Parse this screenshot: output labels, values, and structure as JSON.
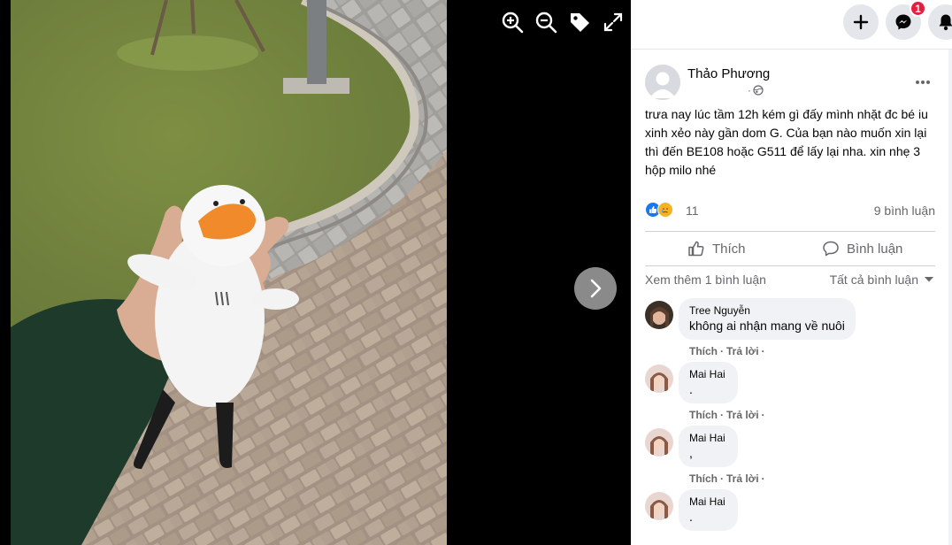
{
  "viewer": {
    "tools": [
      {
        "name": "zoom-in-icon"
      },
      {
        "name": "zoom-out-icon"
      },
      {
        "name": "tag-icon"
      },
      {
        "name": "fullscreen-icon"
      }
    ],
    "next_icon": "chevron-right-icon"
  },
  "topbar": {
    "create_icon": "plus-icon",
    "messenger_icon": "messenger-icon",
    "messenger_badge": "1",
    "notifications_icon": "bell-icon"
  },
  "post": {
    "author": "Thảo Phương",
    "meta_separator": "·",
    "privacy_icon": "public-globe-icon",
    "text": "trưa nay lúc tầm 12h kém gì đấy mình nhặt đc bé iu xinh xẻo này gần dom G. Của bạn nào muốn xin lại thì đến BE108 hoặc G511 để lấy lại nha. xin nhẹ 3 hộp milo nhé",
    "reactions": [
      "like",
      "care"
    ],
    "reaction_count": "11",
    "comment_count": "9 bình luận",
    "like_label": "Thích",
    "comment_label": "Bình luận",
    "view_more": "Xem thêm 1 bình luận",
    "filter_label": "Tất cả bình luận"
  },
  "comments": [
    {
      "name": "Tree Nguyễn",
      "text": "không ai nhận mang về nuôi",
      "like": "Thích",
      "reply": "Trả lời",
      "sep": "·"
    },
    {
      "name": "Mai Hai",
      "text": ".",
      "like": "Thích",
      "reply": "Trả lời",
      "sep": "·"
    },
    {
      "name": "Mai Hai",
      "text": ",",
      "like": "Thích",
      "reply": "Trả lời",
      "sep": "·"
    },
    {
      "name": "Mai Hai",
      "text": ".",
      "like": "Thích",
      "reply": "Trả lời",
      "sep": "·"
    }
  ],
  "colors": {
    "accent": "#1877f2",
    "badge": "#e41e3f",
    "secondary_text": "#65676b"
  }
}
